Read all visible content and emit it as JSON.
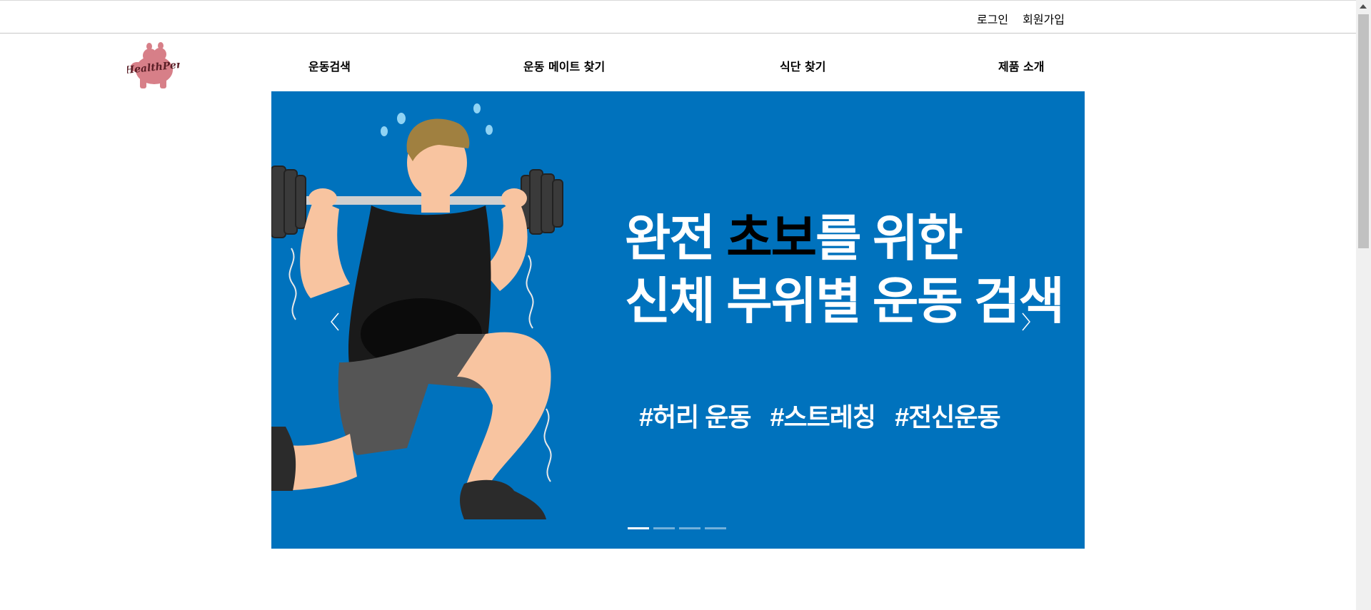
{
  "header": {
    "login": "로그인",
    "signup": "회원가입",
    "logo_text": "HealthPer"
  },
  "nav": {
    "items": [
      {
        "label": "운동검색"
      },
      {
        "label": "운동 메이트 찾기"
      },
      {
        "label": "식단 찾기"
      },
      {
        "label": "제품 소개"
      }
    ]
  },
  "banner": {
    "line1_before": "완전 ",
    "line1_highlight": "초보",
    "line1_after": "를 위한",
    "line2": "신체 부위별 운동 검색",
    "tags": [
      "#허리 운동",
      "#스트레칭",
      "#전신운동"
    ],
    "slide_count": 4,
    "active_slide": 1,
    "background_color": "#0072bd",
    "highlight_color": "#000000"
  },
  "icons": {
    "prev": "chevron-left-icon",
    "next": "chevron-right-icon",
    "logo": "hippo-logo-icon"
  }
}
